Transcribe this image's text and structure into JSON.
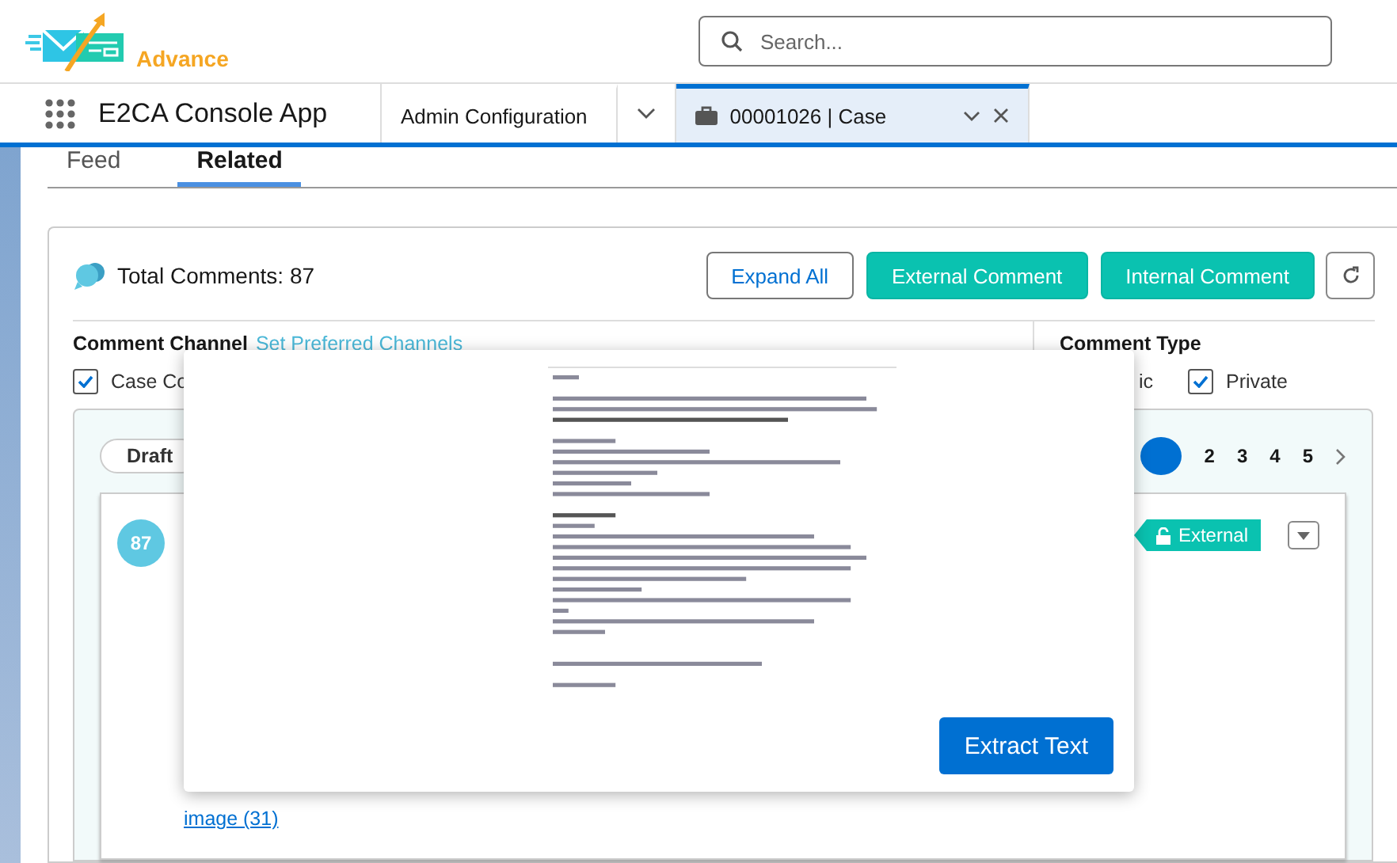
{
  "header": {
    "logo_text": "Advance",
    "search": {
      "placeholder": "Search..."
    }
  },
  "nav": {
    "app_name": "E2CA Console App",
    "tabs": [
      {
        "label": "Admin Configuration",
        "kind": "plain",
        "selected": false
      },
      {
        "label": "00001026 | Case",
        "kind": "record",
        "selected": true
      }
    ]
  },
  "record_tabs": [
    {
      "label": "Feed",
      "selected": false
    },
    {
      "label": "Related",
      "selected": true
    }
  ],
  "comments": {
    "total_label": "Total Comments:",
    "total": "87",
    "buttons": [
      {
        "label": "Expand All",
        "kind": "outline"
      },
      {
        "label": "External Comment",
        "kind": "filled"
      },
      {
        "label": "Internal Comment",
        "kind": "filled"
      }
    ],
    "channel": {
      "heading": "Comment Channel",
      "link": "Set Preferred Channels",
      "options": [
        {
          "label": "Case Co",
          "checked": true
        }
      ]
    },
    "type": {
      "heading": "Comment Type",
      "options": [
        {
          "label": "ic",
          "kind": "label_only"
        },
        {
          "label": "Private",
          "kind": "checkbox",
          "checked": true
        }
      ]
    },
    "filter": "Draft",
    "pages": [
      "2",
      "3",
      "4",
      "5"
    ],
    "card": {
      "number": "87",
      "tag": "External",
      "attachment": "image (31)"
    }
  },
  "popup": {
    "button": "Extract Text"
  }
}
